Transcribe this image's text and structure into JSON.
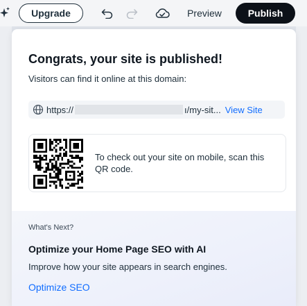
{
  "toolbar": {
    "upgrade_label": "Upgrade",
    "preview_label": "Preview",
    "publish_label": "Publish",
    "icons": [
      "sparkle-icon",
      "undo-icon",
      "redo-icon",
      "cloud-save-icon"
    ]
  },
  "panel": {
    "title": "Congrats, your site is published!",
    "subtitle": "Visitors can find it online at this domain:",
    "url_prefix": "https://",
    "url_suffix": "ı/my-sit...",
    "view_site_label": "View Site",
    "qr_text": "To check out your site on mobile, scan this QR code."
  },
  "whats_next": {
    "label": "What's Next?",
    "title": "Optimize your Home Page SEO with AI",
    "description": "Improve how your site appears in search engines.",
    "link_label": "Optimize SEO"
  },
  "colors": {
    "accent": "#116dff",
    "publish_bg": "#0c1118",
    "text": "#20303c"
  }
}
